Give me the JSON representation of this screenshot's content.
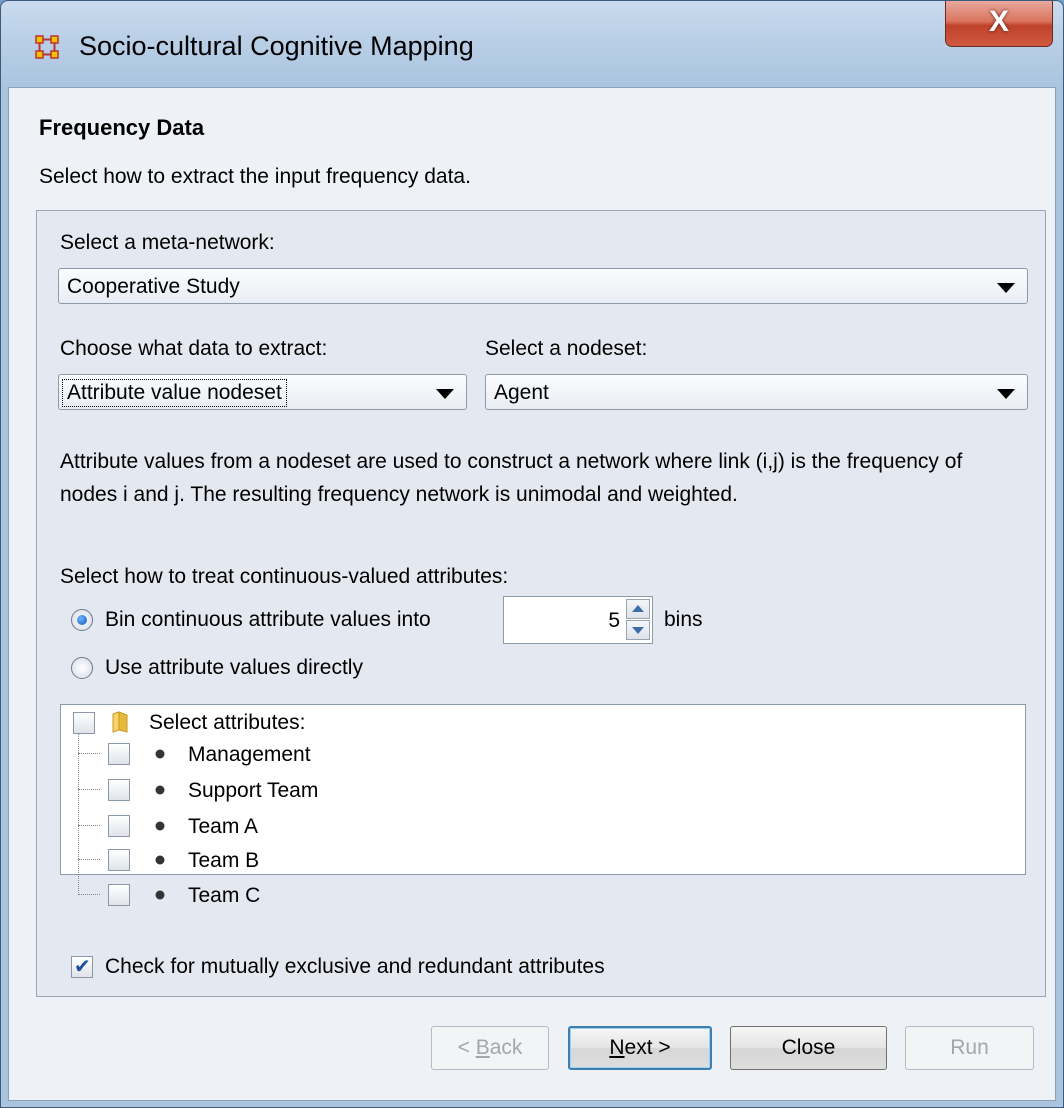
{
  "window": {
    "title": "Socio-cultural Cognitive Mapping",
    "close_label": "X"
  },
  "panel": {
    "title": "Frequency Data",
    "subtitle": "Select how to extract the input frequency data."
  },
  "meta_network": {
    "label": "Select a meta-network:",
    "value": "Cooperative Study"
  },
  "extract": {
    "label": "Choose what data to extract:",
    "value": "Attribute value nodeset"
  },
  "nodeset": {
    "label": "Select a nodeset:",
    "value": "Agent"
  },
  "description": "Attribute values from a nodeset are used to construct a network where link (i,j) is the frequency of nodes i and j. The resulting frequency network is unimodal and weighted.",
  "continuous": {
    "label": "Select how to treat continuous-valued attributes:",
    "bin_option": "Bin continuous attribute values into",
    "bin_count": "5",
    "bins_suffix": "bins",
    "direct_option": "Use attribute values directly",
    "selected": "bin"
  },
  "attributes": {
    "root_label": "Select attributes:",
    "items": [
      {
        "label": "Management",
        "checked": false
      },
      {
        "label": "Support Team",
        "checked": false
      },
      {
        "label": "Team A",
        "checked": false
      },
      {
        "label": "Team B",
        "checked": false
      },
      {
        "label": "Team C",
        "checked": false
      }
    ]
  },
  "check_exclusive": {
    "label": "Check for mutually exclusive and redundant attributes",
    "checked": true
  },
  "buttons": {
    "back_prefix": "< ",
    "back_mnemonic": "B",
    "back_rest": "ack",
    "next_mnemonic": "N",
    "next_rest": "ext >",
    "close": "Close",
    "run": "Run"
  }
}
